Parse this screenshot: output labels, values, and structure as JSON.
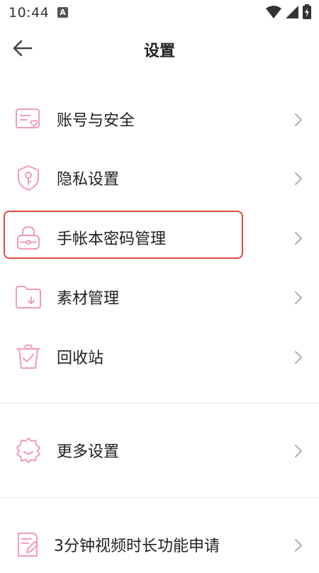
{
  "status_bar": {
    "time": "10:44",
    "notification_badge": "A"
  },
  "header": {
    "title": "设置"
  },
  "menu": {
    "group1": [
      {
        "label": "账号与安全",
        "icon": "account-card-icon"
      },
      {
        "label": "隐私设置",
        "icon": "privacy-shield-key-icon"
      },
      {
        "label": "手帐本密码管理",
        "icon": "lock-icon"
      },
      {
        "label": "素材管理",
        "icon": "folder-icon"
      },
      {
        "label": "回收站",
        "icon": "trash-bin-icon"
      }
    ],
    "group2": [
      {
        "label": "更多设置",
        "icon": "gear-icon"
      }
    ],
    "group3": [
      {
        "label": "3分钟视频时长功能申请",
        "icon": "document-edit-icon"
      }
    ]
  },
  "colors": {
    "icon_accent": "#f19bbd",
    "highlight_border": "#e0493b",
    "chevron": "#b0b0b0"
  }
}
